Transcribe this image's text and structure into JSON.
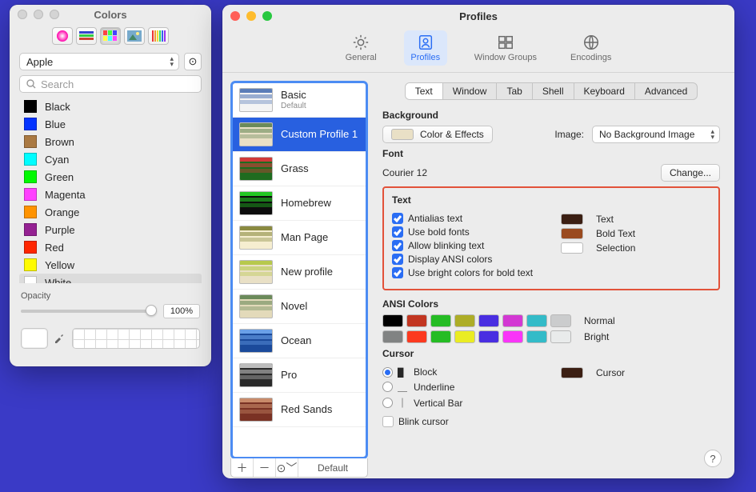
{
  "colors_window": {
    "title": "Colors",
    "palette_name": "Apple",
    "search_placeholder": "Search",
    "items": [
      {
        "name": "Black",
        "hex": "#000000"
      },
      {
        "name": "Blue",
        "hex": "#0433ff"
      },
      {
        "name": "Brown",
        "hex": "#aa7942"
      },
      {
        "name": "Cyan",
        "hex": "#00fdff"
      },
      {
        "name": "Green",
        "hex": "#00f900"
      },
      {
        "name": "Magenta",
        "hex": "#ff40ff"
      },
      {
        "name": "Orange",
        "hex": "#ff9300"
      },
      {
        "name": "Purple",
        "hex": "#942192"
      },
      {
        "name": "Red",
        "hex": "#ff2600"
      },
      {
        "name": "Yellow",
        "hex": "#fffb00"
      },
      {
        "name": "White",
        "hex": "#ffffff"
      }
    ],
    "selected_item": "White",
    "opacity_label": "Opacity",
    "opacity_value": "100%"
  },
  "profiles_window": {
    "title": "Profiles",
    "toolbar": {
      "general": "General",
      "profiles": "Profiles",
      "window_groups": "Window Groups",
      "encodings": "Encodings"
    },
    "profiles": [
      {
        "name": "Basic",
        "sub": "Default",
        "thumb_bg": "#f4f4f4",
        "thumb_accent": "#5b7db8"
      },
      {
        "name": "Custom Profile 1",
        "sub": "",
        "thumb_bg": "#e9e0c6",
        "thumb_accent": "#6b8a5a",
        "selected": true
      },
      {
        "name": "Grass",
        "sub": "",
        "thumb_bg": "#1f6b1f",
        "thumb_accent": "#d03a3a"
      },
      {
        "name": "Homebrew",
        "sub": "",
        "thumb_bg": "#0c0c0c",
        "thumb_accent": "#23c723"
      },
      {
        "name": "Man Page",
        "sub": "",
        "thumb_bg": "#f6eed0",
        "thumb_accent": "#8a8a40"
      },
      {
        "name": "New profile",
        "sub": "",
        "thumb_bg": "#e9e0c6",
        "thumb_accent": "#b7c94c"
      },
      {
        "name": "Novel",
        "sub": "",
        "thumb_bg": "#e3daba",
        "thumb_accent": "#6b8a5a"
      },
      {
        "name": "Ocean",
        "sub": "",
        "thumb_bg": "#1b4a9b",
        "thumb_accent": "#6aa0e8"
      },
      {
        "name": "Pro",
        "sub": "",
        "thumb_bg": "#2a2a2a",
        "thumb_accent": "#bdbdbd"
      },
      {
        "name": "Red Sands",
        "sub": "",
        "thumb_bg": "#7a3224",
        "thumb_accent": "#c88a6a"
      }
    ],
    "footer_default": "Default",
    "detail_tabs": [
      "Text",
      "Window",
      "Tab",
      "Shell",
      "Keyboard",
      "Advanced"
    ],
    "detail_tab_selected": "Text",
    "background": {
      "heading": "Background",
      "color_effects": "Color & Effects",
      "swatch": "#e9e0c6",
      "image_label": "Image:",
      "image_value": "No Background Image"
    },
    "font": {
      "heading": "Font",
      "value": "Courier 12",
      "change": "Change..."
    },
    "text": {
      "heading": "Text",
      "antialias": "Antialias text",
      "bold_fonts": "Use bold fonts",
      "blinking": "Allow blinking text",
      "ansi": "Display ANSI colors",
      "bright_bold": "Use bright colors for bold text",
      "text_label": "Text",
      "text_color": "#3b1f13",
      "bold_label": "Bold Text",
      "bold_color": "#9a4a1f",
      "selection_label": "Selection",
      "selection_color": "#ffffff"
    },
    "ansi": {
      "heading": "ANSI Colors",
      "normal_label": "Normal",
      "bright_label": "Bright",
      "normal": [
        "#000000",
        "#c23621",
        "#25bc24",
        "#adad27",
        "#492ee1",
        "#d338d3",
        "#33bbc8",
        "#cbcccd"
      ],
      "bright": [
        "#818383",
        "#fc391f",
        "#25bc24",
        "#eaec23",
        "#492ee1",
        "#f935f8",
        "#33bbc8",
        "#e9ebeb"
      ]
    },
    "cursor": {
      "heading": "Cursor",
      "block": "Block",
      "underline": "Underline",
      "vbar": "Vertical Bar",
      "blink": "Blink cursor",
      "cursor_label": "Cursor",
      "cursor_color": "#3b1f13"
    }
  }
}
